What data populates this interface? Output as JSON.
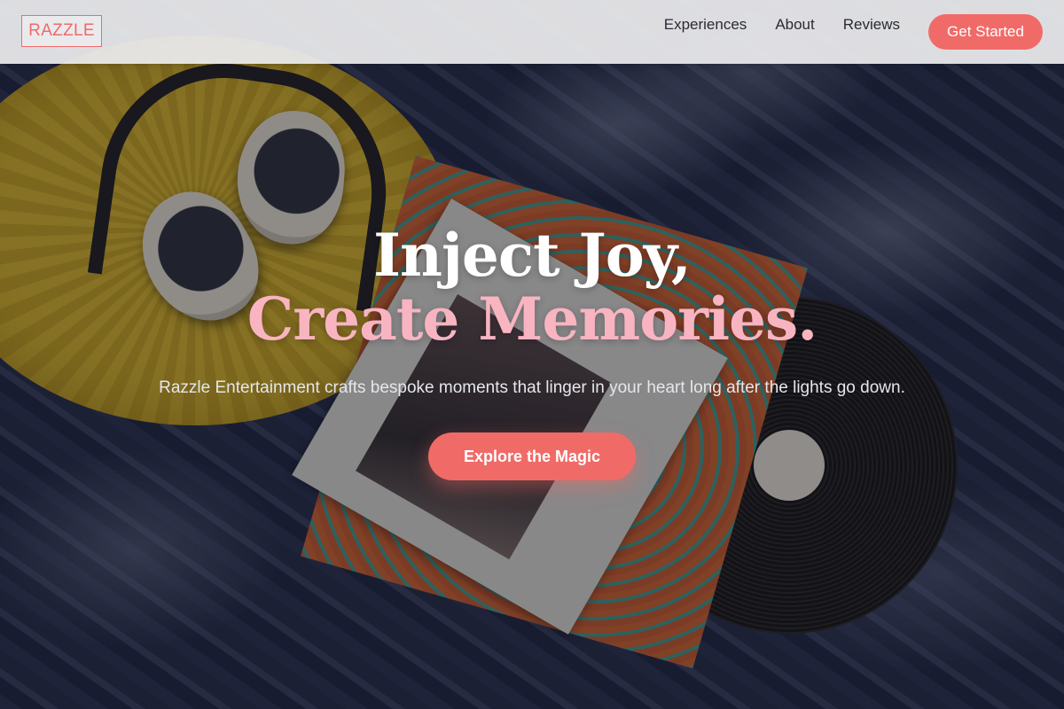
{
  "nav": {
    "logo": "RAZZLE",
    "links": [
      "Experiences",
      "About",
      "Reviews"
    ],
    "cta_label": "Get Started"
  },
  "hero": {
    "headline_line1": "Inject Joy,",
    "headline_line2": "Create Memories.",
    "subtitle": "Razzle Entertainment crafts bespoke moments that linger in your heart long after the lights go down.",
    "cta_label": "Explore the Magic"
  },
  "colors": {
    "accent": "#f06b68",
    "headline_highlight": "#f9b4c1",
    "nav_background": "#ececee"
  }
}
